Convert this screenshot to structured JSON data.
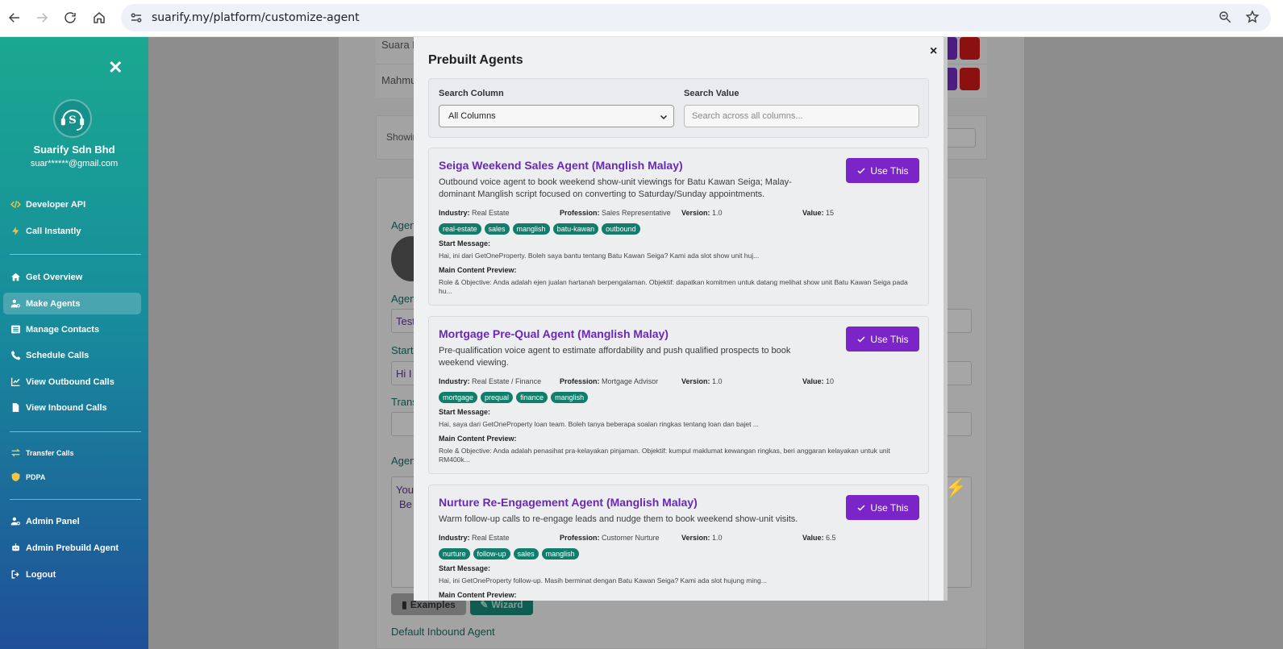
{
  "browser": {
    "url": "suarify.my/platform/customize-agent"
  },
  "sidebar": {
    "org_name": "Suarify Sdn Bhd",
    "email": "suar******@gmail.com",
    "items": [
      {
        "label": "Developer API",
        "icon": "code-icon"
      },
      {
        "label": "Call Instantly",
        "icon": "bolt-icon"
      },
      {
        "label": "Get Overview",
        "icon": "home-icon"
      },
      {
        "label": "Make Agents",
        "icon": "user-gear-icon"
      },
      {
        "label": "Manage Contacts",
        "icon": "list-icon"
      },
      {
        "label": "Schedule Calls",
        "icon": "phone-icon"
      },
      {
        "label": "View Outbound Calls",
        "icon": "chart-line-icon"
      },
      {
        "label": "View Inbound Calls",
        "icon": "file-icon"
      },
      {
        "label": "Transfer Calls",
        "icon": "transfer-icon"
      },
      {
        "label": "PDPA",
        "icon": "shield-icon"
      },
      {
        "label": "Admin Panel",
        "icon": "user-gear-icon"
      },
      {
        "label": "Admin Prebuild Agent",
        "icon": "robot-icon"
      },
      {
        "label": "Logout",
        "icon": "logout-icon"
      }
    ]
  },
  "background": {
    "row1": "Suara F",
    "row2": "Mahmu",
    "showing": "Showin",
    "agent_label": "Agen",
    "agent_name_label": "Agen",
    "agent_name_value": "Test",
    "start_label": "Start",
    "start_value": "Hi I",
    "trans_label": "Trans",
    "agent_prompt_label": "Agen",
    "prompt_line1": "You",
    "prompt_line2": "Be",
    "examples_label": "Examples",
    "wizard_label": "Wizard",
    "default_inbound": "Default Inbound Agent"
  },
  "modal": {
    "title": "Prebuilt Agents",
    "close": "×",
    "search_column_label": "Search Column",
    "search_column_value": "All Columns",
    "search_value_label": "Search Value",
    "search_value_placeholder": "Search across all columns...",
    "use_label": "Use This",
    "industry_label": "Industry:",
    "profession_label": "Profession:",
    "version_label": "Version:",
    "value_label": "Value:",
    "start_message_label": "Start Message:",
    "main_content_label": "Main Content Preview:",
    "agents": [
      {
        "name": "Seiga Weekend Sales Agent (Manglish Malay)",
        "description": "Outbound voice agent to book weekend show-unit viewings for Batu Kawan Seiga; Malay-dominant Manglish script focused on converting to Saturday/Sunday appointments.",
        "industry": "Real Estate",
        "profession": "Sales Representative",
        "version": "1.0",
        "value": "15",
        "tags": [
          "real-estate",
          "sales",
          "manglish",
          "batu-kawan",
          "outbound"
        ],
        "start_message": "Hai, ini dari GetOneProperty. Boleh saya bantu tentang Batu Kawan Seiga? Kami ada slot show unit huj...",
        "main_content": "Role & Objective: Anda adalah ejen jualan hartanah berpengalaman. Objektif: dapatkan komitmen untuk datang melihat show unit Batu Kawan Seiga pada hu..."
      },
      {
        "name": "Mortgage Pre-Qual Agent (Manglish Malay)",
        "description": "Pre-qualification voice agent to estimate affordability and push qualified prospects to book weekend viewing.",
        "industry": "Real Estate / Finance",
        "profession": "Mortgage Advisor",
        "version": "1.0",
        "value": "10",
        "tags": [
          "mortgage",
          "prequal",
          "finance",
          "manglish"
        ],
        "start_message": "Hai, saya dari GetOneProperty loan team. Boleh tanya beberapa soalan ringkas tentang loan dan bajet ...",
        "main_content": "Role & Objective: Anda adalah penasihat pra-kelayakan pinjaman. Objektif: kumpul maklumat kewangan ringkas, beri anggaran kelayakan untuk unit RM400k..."
      },
      {
        "name": "Nurture Re-Engagement Agent (Manglish Malay)",
        "description": "Warm follow-up calls to re-engage leads and nudge them to book weekend show-unit visits.",
        "industry": "Real Estate",
        "profession": "Customer Nurture",
        "version": "1.0",
        "value": "6.5",
        "tags": [
          "nurture",
          "follow-up",
          "sales",
          "manglish"
        ],
        "start_message": "Hai, ini GetOneProperty follow-up. Masih berminat dengan Batu Kawan Seiga? Kami ada slot hujung ming...",
        "main_content": ""
      }
    ]
  }
}
